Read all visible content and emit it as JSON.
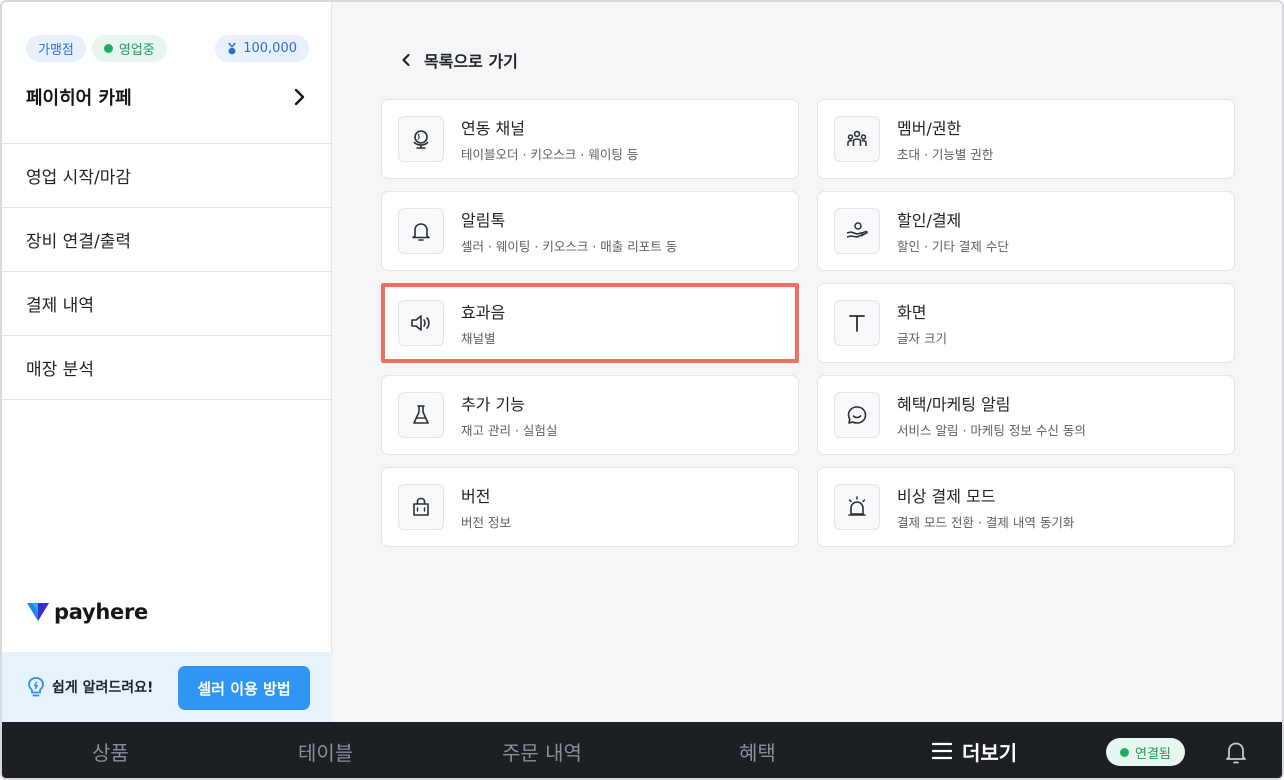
{
  "sidebar": {
    "badge_franchise": "가맹점",
    "badge_status": "영업중",
    "points": "100,000",
    "store_name": "페이히어 카페",
    "menu": [
      {
        "label": "영업 시작/마감"
      },
      {
        "label": "장비 연결/출력"
      },
      {
        "label": "결제 내역"
      },
      {
        "label": "매장 분석"
      }
    ],
    "logo_text": "payhere",
    "help_text": "쉽게 알려드려요!",
    "help_button": "셀러 이용 방법"
  },
  "main": {
    "back_label": "목록으로 가기",
    "cards": [
      {
        "title": "연동 채널",
        "sub": "테이블오더 · 키오스크 · 웨이팅 등",
        "icon": "globe-icon"
      },
      {
        "title": "멤버/권한",
        "sub": "초대 · 기능별 권한",
        "icon": "members-icon"
      },
      {
        "title": "알림톡",
        "sub": "셀러 · 웨이팅 · 키오스크 · 매출 리포트 등",
        "icon": "bell-icon"
      },
      {
        "title": "할인/결제",
        "sub": "할인 · 기타 결제 수단",
        "icon": "hand-coin-icon"
      },
      {
        "title": "효과음",
        "sub": "채널별",
        "icon": "speaker-icon",
        "selected": true
      },
      {
        "title": "화면",
        "sub": "글자 크기",
        "icon": "text-t-icon"
      },
      {
        "title": "추가 기능",
        "sub": "재고 관리 · 실험실",
        "icon": "flask-icon"
      },
      {
        "title": "혜택/마케팅 알림",
        "sub": "서비스 알림 · 마케팅 정보 수신 동의",
        "icon": "chat-smile-icon"
      },
      {
        "title": "버전",
        "sub": "버전 정보",
        "icon": "bag-icon"
      },
      {
        "title": "비상 결제 모드",
        "sub": "결제 모드 전환 · 결제 내역 동기화",
        "icon": "alarm-light-icon"
      }
    ]
  },
  "bottom_nav": {
    "tabs": [
      {
        "label": "상품"
      },
      {
        "label": "테이블"
      },
      {
        "label": "주문 내역"
      },
      {
        "label": "혜택"
      },
      {
        "label": "더보기"
      }
    ],
    "connection_status": "연결됨"
  },
  "colors": {
    "accent_blue": "#3196f3",
    "selected_border": "#f06f5e",
    "status_green": "#1fae63",
    "bottom_bar": "#1c1f24"
  }
}
